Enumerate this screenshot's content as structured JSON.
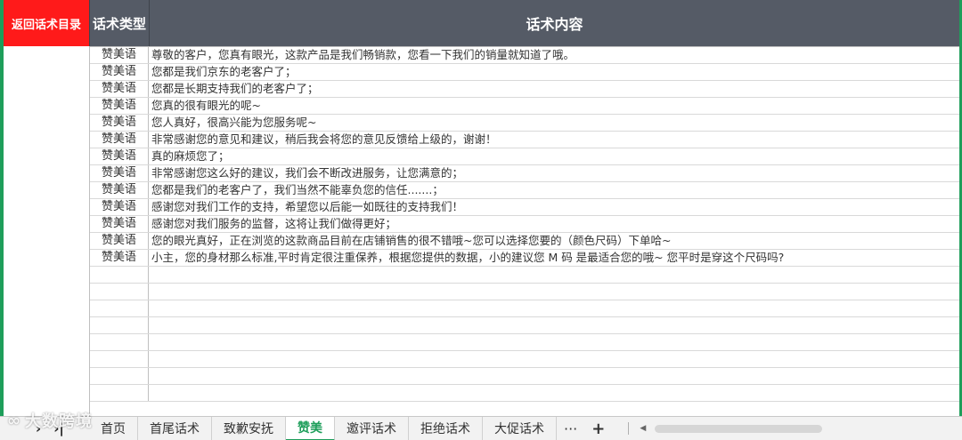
{
  "header": {
    "back_button": "返回话术目录",
    "col_type": "话术类型",
    "col_content": "话术内容"
  },
  "rows": [
    {
      "type": "赞美语",
      "text": "尊敬的客户，您真有眼光，这款产品是我们畅销款，您看一下我们的销量就知道了哦。"
    },
    {
      "type": "赞美语",
      "text": "您都是我们京东的老客户了；"
    },
    {
      "type": "赞美语",
      "text": "您都是长期支持我们的老客户了；"
    },
    {
      "type": "赞美语",
      "text": "您真的很有眼光的呢~"
    },
    {
      "type": "赞美语",
      "text": "您人真好，很高兴能为您服务呢~"
    },
    {
      "type": "赞美语",
      "text": "非常感谢您的意见和建议，稍后我会将您的意见反馈给上级的，谢谢！"
    },
    {
      "type": "赞美语",
      "text": "真的麻烦您了；"
    },
    {
      "type": "赞美语",
      "text": "非常感谢您这么好的建议，我们会不断改进服务，让您满意的；"
    },
    {
      "type": "赞美语",
      "text": "您都是我们的老客户了，我们当然不能辜负您的信任.......；"
    },
    {
      "type": "赞美语",
      "text": "感谢您对我们工作的支持，希望您以后能一如既往的支持我们！"
    },
    {
      "type": "赞美语",
      "text": "感谢您对我们服务的监督，这将让我们做得更好；"
    },
    {
      "type": "赞美语",
      "text": "您的眼光真好，正在浏览的这款商品目前在店铺销售的很不错哦~您可以选择您要的（颜色尺码）下单哈~"
    },
    {
      "type": "赞美语",
      "text": "小主，您的身材那么标准,平时肯定很注重保养，根据您提供的数据，小的建议您 M 码 是最适合您的哦~ 您平时是穿这个尺码吗?"
    }
  ],
  "tabs": [
    {
      "label": "首页"
    },
    {
      "label": "首尾话术"
    },
    {
      "label": "致歉安抚"
    },
    {
      "label": "赞美"
    },
    {
      "label": "邀评话术"
    },
    {
      "label": "拒绝话术"
    },
    {
      "label": "大促话术"
    }
  ],
  "active_tab": "赞美",
  "tabbar": {
    "nav_prev": "›",
    "nav_last": "›|",
    "more": "···",
    "add": "+",
    "scroll_left": "◀"
  },
  "watermark": "大数跨境",
  "colors": {
    "back_button_bg": "#ff1a1a",
    "header_bg": "#555b66",
    "accent_green": "#1e9e5a"
  }
}
